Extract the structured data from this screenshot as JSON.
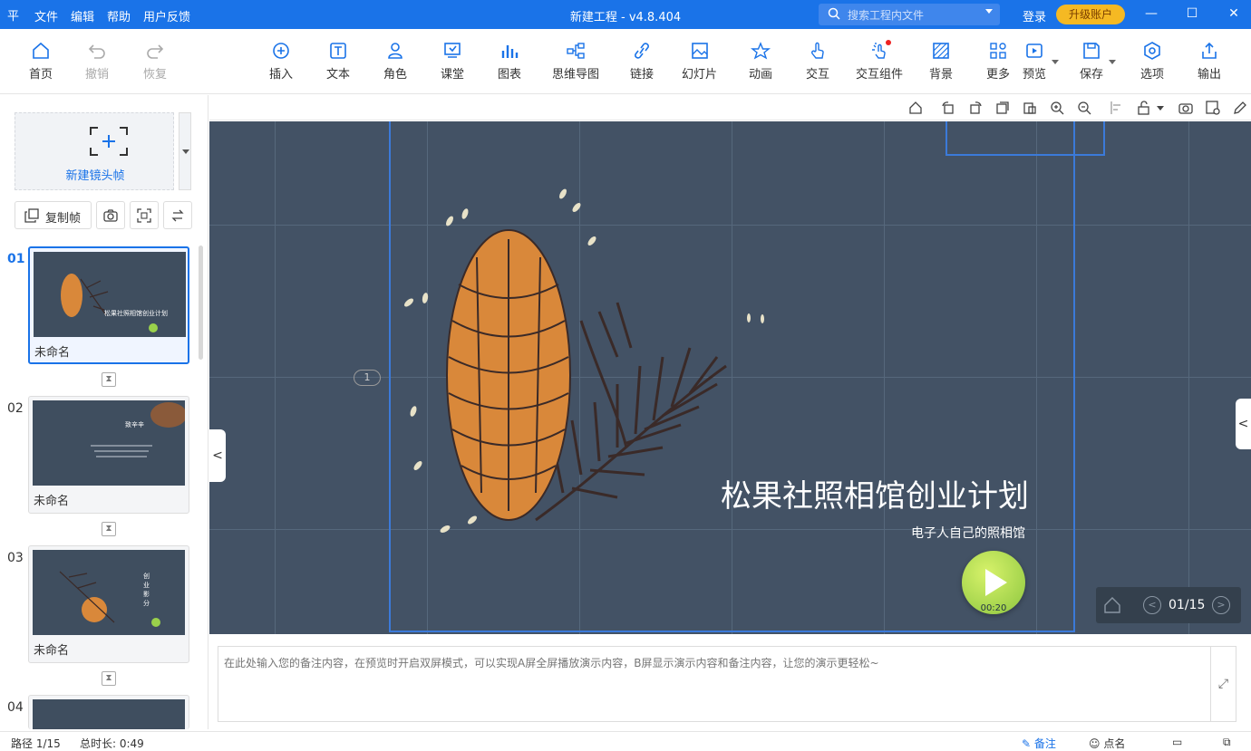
{
  "titlebar": {
    "app_icon": "平",
    "menus": [
      "文件",
      "编辑",
      "帮助",
      "用户反馈"
    ],
    "title": "新建工程 - v4.8.404",
    "search_placeholder": "搜索工程内文件",
    "login": "登录",
    "upgrade": "升级账户"
  },
  "toolbar": {
    "home": "首页",
    "undo": "撤销",
    "redo": "恢复",
    "insert": "插入",
    "text": "文本",
    "role": "角色",
    "classroom": "课堂",
    "chart": "图表",
    "mindmap": "思维导图",
    "link": "链接",
    "slideshow": "幻灯片",
    "animation": "动画",
    "interact": "交互",
    "interact_comp": "交互组件",
    "background": "背景",
    "more": "更多",
    "preview": "预览",
    "save": "保存",
    "options": "选项",
    "export": "输出"
  },
  "leftpanel": {
    "new_frame": "新建镜头帧",
    "copy_frame": "复制帧",
    "frames": [
      {
        "num": "01",
        "name": "未命名"
      },
      {
        "num": "02",
        "name": "未命名"
      },
      {
        "num": "03",
        "name": "未命名"
      },
      {
        "num": "04",
        "name": ""
      }
    ],
    "thumb1_title": "松果社照相馆创业计划",
    "thumb2_title": "致辛辛",
    "thumb3_title": "创业影分"
  },
  "stage": {
    "frame_badge": "1",
    "title": "松果社照相馆创业计划",
    "subtitle": "电子人自己的照相馆",
    "play_time": "00:20",
    "page_indicator": "01/15",
    "bg_color": "#435265",
    "accent": "#3b7ad9"
  },
  "notes": {
    "placeholder": "在此处输入您的备注内容，在预览时开启双屏模式，可以实现A屏全屏播放演示内容，B屏显示演示内容和备注内容，让您的演示更轻松~"
  },
  "statusbar": {
    "path": "路径 1/15",
    "duration": "总时长: 0:49",
    "notes_btn": "备注",
    "roll_btn": "点名"
  }
}
